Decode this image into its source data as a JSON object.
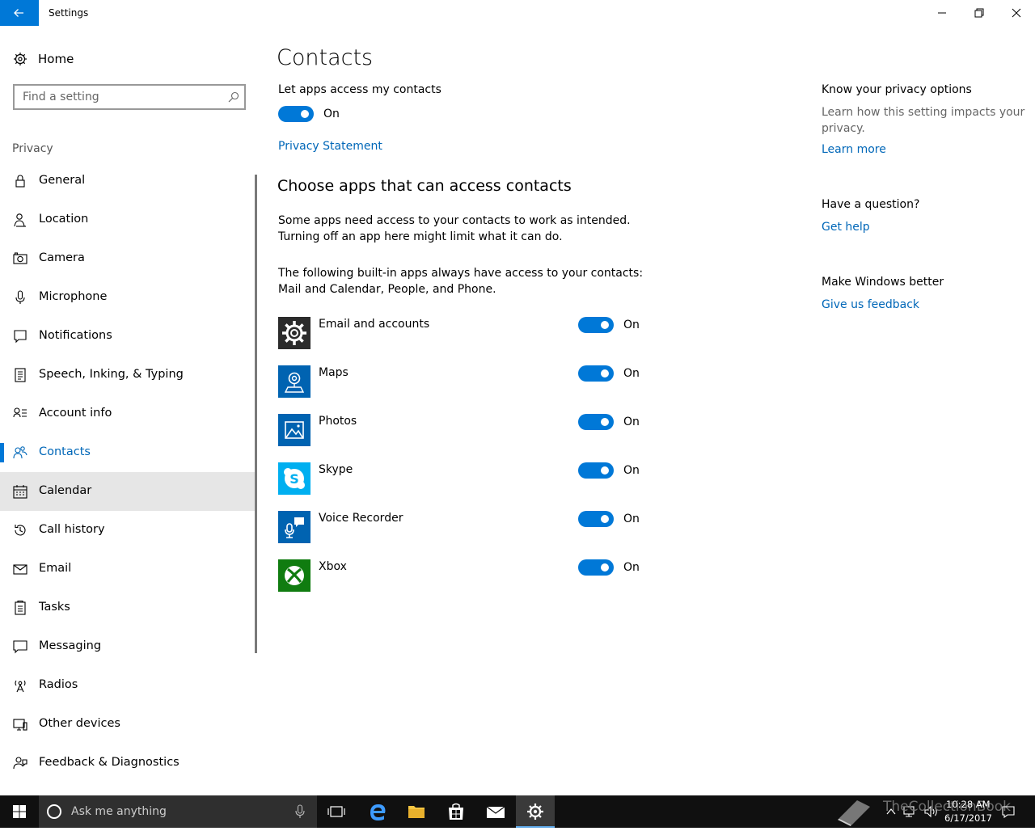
{
  "window": {
    "title": "Settings"
  },
  "sidebar": {
    "home_label": "Home",
    "search_placeholder": "Find a setting",
    "section_label": "Privacy",
    "items": [
      {
        "label": "General",
        "icon": "lock-icon"
      },
      {
        "label": "Location",
        "icon": "location-person-icon"
      },
      {
        "label": "Camera",
        "icon": "camera-icon"
      },
      {
        "label": "Microphone",
        "icon": "microphone-icon"
      },
      {
        "label": "Notifications",
        "icon": "notifications-icon"
      },
      {
        "label": "Speech, Inking, & Typing",
        "icon": "speech-icon"
      },
      {
        "label": "Account info",
        "icon": "account-info-icon"
      },
      {
        "label": "Contacts",
        "icon": "contacts-icon",
        "active": true
      },
      {
        "label": "Calendar",
        "icon": "calendar-icon",
        "hover": true
      },
      {
        "label": "Call history",
        "icon": "history-icon"
      },
      {
        "label": "Email",
        "icon": "email-icon"
      },
      {
        "label": "Tasks",
        "icon": "tasks-icon"
      },
      {
        "label": "Messaging",
        "icon": "messaging-icon"
      },
      {
        "label": "Radios",
        "icon": "radios-icon"
      },
      {
        "label": "Other devices",
        "icon": "other-devices-icon"
      },
      {
        "label": "Feedback & Diagnostics",
        "icon": "feedback-icon"
      }
    ]
  },
  "main": {
    "title": "Contacts",
    "master_toggle_label": "Let apps access my contacts",
    "master_toggle_state": "On",
    "privacy_statement": "Privacy Statement",
    "apps_heading": "Choose apps that can access contacts",
    "desc_line1": "Some apps need access to your contacts to work as intended.",
    "desc_line2": "Turning off an app here might limit what it can do.",
    "builtin_line1": "The following built-in apps always have access to your contacts:",
    "builtin_line2": "Mail and Calendar, People, and Phone.",
    "apps": [
      {
        "name": "Email and accounts",
        "state": "On",
        "tile_color": "#2b2b2b",
        "icon": "gear-tile-icon"
      },
      {
        "name": "Maps",
        "state": "On",
        "tile_color": "#0063b1",
        "icon": "maps-tile-icon"
      },
      {
        "name": "Photos",
        "state": "On",
        "tile_color": "#0063b1",
        "icon": "photos-tile-icon"
      },
      {
        "name": "Skype",
        "state": "On",
        "tile_color": "#00aff0",
        "icon": "skype-tile-icon"
      },
      {
        "name": "Voice Recorder",
        "state": "On",
        "tile_color": "#0063b1",
        "icon": "voice-recorder-tile-icon"
      },
      {
        "name": "Xbox",
        "state": "On",
        "tile_color": "#107c10",
        "icon": "xbox-tile-icon"
      }
    ]
  },
  "right_panel": {
    "privacy_heading": "Know your privacy options",
    "privacy_desc_line1": "Learn how this setting impacts your",
    "privacy_desc_line2": "privacy.",
    "learn_more": "Learn more",
    "question_heading": "Have a question?",
    "get_help": "Get help",
    "better_heading": "Make Windows better",
    "feedback_link": "Give us feedback"
  },
  "taskbar": {
    "search_placeholder": "Ask me anything",
    "time": "10:28 AM",
    "date": "6/17/2017",
    "watermark": "TheCollectionBook"
  },
  "colors": {
    "accent": "#0078d7",
    "link": "#0067b8",
    "taskbar": "#101010"
  }
}
